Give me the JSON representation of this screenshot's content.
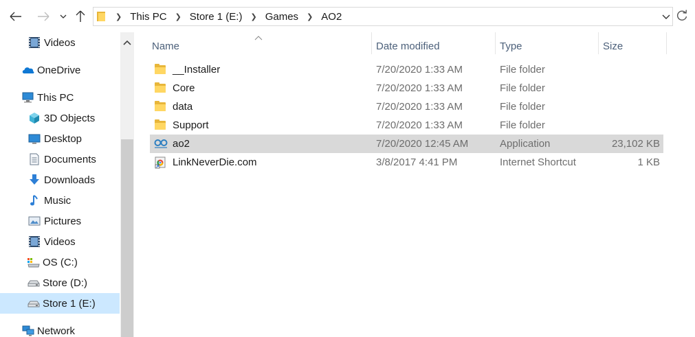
{
  "address_bar": {
    "crumbs": [
      "This PC",
      "Store 1 (E:)",
      "Games",
      "AO2"
    ]
  },
  "nav_pane": {
    "items": [
      {
        "label": "Videos",
        "icon": "videos-icon",
        "indent": 1,
        "selected": false
      },
      {
        "label": "OneDrive",
        "icon": "onedrive-icon",
        "indent": 0,
        "selected": false
      },
      {
        "label": "This PC",
        "icon": "this-pc-icon",
        "indent": 0,
        "selected": false
      },
      {
        "label": "3D Objects",
        "icon": "3d-objects-icon",
        "indent": 1,
        "selected": false
      },
      {
        "label": "Desktop",
        "icon": "desktop-icon",
        "indent": 1,
        "selected": false
      },
      {
        "label": "Documents",
        "icon": "documents-icon",
        "indent": 1,
        "selected": false
      },
      {
        "label": "Downloads",
        "icon": "downloads-icon",
        "indent": 1,
        "selected": false
      },
      {
        "label": "Music",
        "icon": "music-icon",
        "indent": 1,
        "selected": false
      },
      {
        "label": "Pictures",
        "icon": "pictures-icon",
        "indent": 1,
        "selected": false
      },
      {
        "label": "Videos",
        "icon": "videos-icon",
        "indent": 1,
        "selected": false
      },
      {
        "label": "OS (C:)",
        "icon": "os-drive-icon",
        "indent": 1,
        "selected": false
      },
      {
        "label": "Store (D:)",
        "icon": "drive-icon",
        "indent": 1,
        "selected": false
      },
      {
        "label": "Store 1 (E:)",
        "icon": "drive-icon",
        "indent": 1,
        "selected": true
      },
      {
        "label": "Network",
        "icon": "network-icon",
        "indent": 0,
        "selected": false
      }
    ]
  },
  "file_list": {
    "columns": {
      "name": "Name",
      "date": "Date modified",
      "type": "Type",
      "size": "Size"
    },
    "rows": [
      {
        "name": "__Installer",
        "date": "7/20/2020 1:33 AM",
        "type": "File folder",
        "size": "",
        "icon": "folder-icon",
        "selected": false
      },
      {
        "name": "Core",
        "date": "7/20/2020 1:33 AM",
        "type": "File folder",
        "size": "",
        "icon": "folder-icon",
        "selected": false
      },
      {
        "name": "data",
        "date": "7/20/2020 1:33 AM",
        "type": "File folder",
        "size": "",
        "icon": "folder-icon",
        "selected": false
      },
      {
        "name": "Support",
        "date": "7/20/2020 1:33 AM",
        "type": "File folder",
        "size": "",
        "icon": "folder-icon",
        "selected": false
      },
      {
        "name": "ao2",
        "date": "7/20/2020 12:45 AM",
        "type": "Application",
        "size": "23,102 KB",
        "icon": "ao-application-icon",
        "selected": true
      },
      {
        "name": "LinkNeverDie.com",
        "date": "3/8/2017 4:41 PM",
        "type": "Internet Shortcut",
        "size": "1 KB",
        "icon": "internet-shortcut-icon",
        "selected": false
      }
    ]
  },
  "colors": {
    "folder": "#ffd763",
    "selection_nav": "#cce8ff",
    "selection_row": "#d9d9d9",
    "header_text": "#4c607a",
    "onedrive": "#0f78d4",
    "ao_logo": "#2d7fc1"
  }
}
